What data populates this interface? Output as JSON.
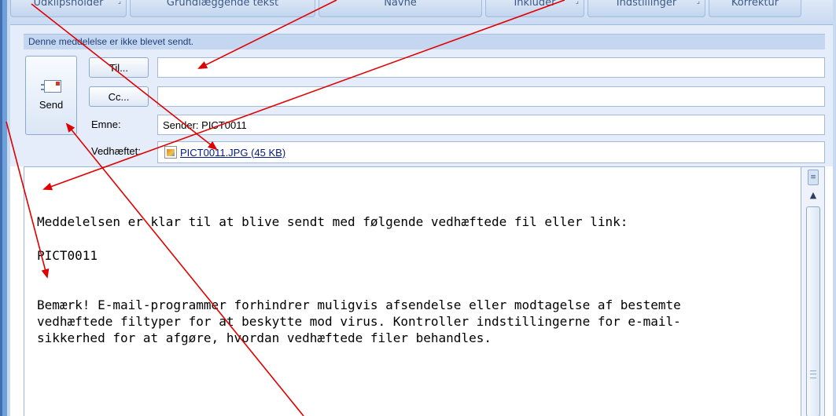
{
  "ribbon": {
    "groups": [
      {
        "label": "Udklipsholder"
      },
      {
        "label": "Grundlæggende tekst"
      },
      {
        "label": "Navne"
      },
      {
        "label": "Inkluder"
      },
      {
        "label": "Indstillinger"
      },
      {
        "label": "Korrektur"
      }
    ]
  },
  "infobar": {
    "text": "Denne meddelelse er ikke blevet sendt."
  },
  "compose": {
    "send_label": "Send",
    "to_button": "Til...",
    "cc_button": "Cc...",
    "to_value": "",
    "cc_value": "",
    "subject_label": "Emne:",
    "subject_value": "Sender: PICT0011",
    "attached_label": "Vedhæftet:",
    "attachment": "PICT0011.JPG (45 KB)"
  },
  "body": {
    "line1": "Meddelelsen er klar til at blive sendt med følgende vedhæftede fil eller link:",
    "line2": "PICT0011",
    "line3": "Bemærk! E-mail-programmer forhindrer muligvis afsendelse eller modtagelse af bestemte",
    "line4": "vedhæftede filtyper for at beskytte mod virus. Kontroller indstillingerne for e-mail-",
    "line5": "sikkerhed for at afgøre, hvordan vedhæftede filer behandles."
  },
  "colors": {
    "annotation_arrow": "#e00000",
    "frame_blue": "#6f9fd8",
    "header_bg": "#e4edf9"
  }
}
